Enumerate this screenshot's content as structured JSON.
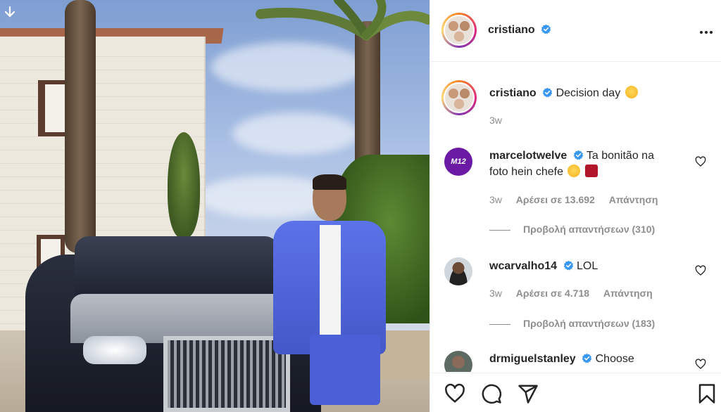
{
  "post": {
    "author": "cristiano",
    "caption": "Decision day",
    "caption_time": "3w"
  },
  "comments": [
    {
      "user": "marcelotwelve",
      "text_line1": "Ta bonitão na",
      "text_line2": "foto hein chefe",
      "time": "3w",
      "likes": "Αρέσει σε 13.692",
      "reply": "Απάντηση",
      "view_replies": "Προβολή απαντήσεων (310)",
      "avatar_label": "M12"
    },
    {
      "user": "wcarvalho14",
      "text_line1": "LOL",
      "time": "3w",
      "likes": "Αρέσει σε 4.718",
      "reply": "Απάντηση",
      "view_replies": "Προβολή απαντήσεων (183)"
    },
    {
      "user": "drmiguelstanley",
      "text_line1": "Choose"
    }
  ],
  "icons": {
    "download": "download-arrow-icon",
    "more": "more-options-icon",
    "verified": "verified-badge-icon",
    "like": "heart-icon",
    "comment": "comment-icon",
    "share": "send-icon",
    "save": "bookmark-icon"
  },
  "colors": {
    "verified": "#3897f0",
    "text": "#262626",
    "secondary": "#8e8e8e",
    "border": "#efefef"
  }
}
